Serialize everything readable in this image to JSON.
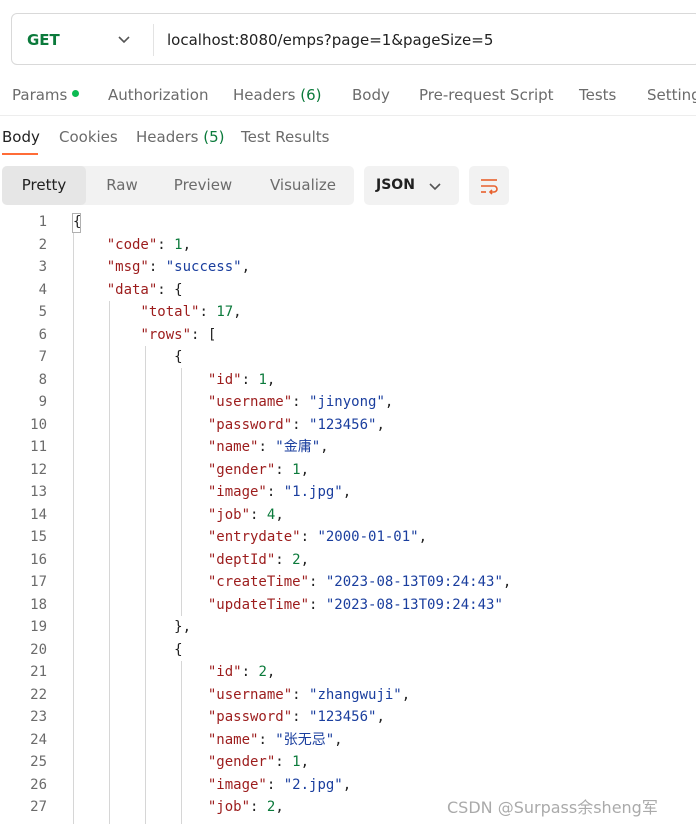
{
  "request": {
    "method": "GET",
    "url": "localhost:8080/emps?page=1&pageSize=5"
  },
  "request_tabs": [
    {
      "label": "Params",
      "count": "",
      "dot": true
    },
    {
      "label": "Authorization",
      "count": ""
    },
    {
      "label": "Headers",
      "count": "(6)"
    },
    {
      "label": "Body",
      "count": ""
    },
    {
      "label": "Pre-request Script",
      "count": ""
    },
    {
      "label": "Tests",
      "count": ""
    },
    {
      "label": "Settings",
      "count": ""
    }
  ],
  "response_tabs": [
    {
      "label": "Body",
      "count": "",
      "active": true
    },
    {
      "label": "Cookies",
      "count": ""
    },
    {
      "label": "Headers",
      "count": "(5)"
    },
    {
      "label": "Test Results",
      "count": ""
    }
  ],
  "format_tabs": [
    "Pretty",
    "Raw",
    "Preview",
    "Visualize"
  ],
  "active_format": "Pretty",
  "language": "JSON",
  "code_lines": [
    {
      "n": "1",
      "t": "{"
    },
    {
      "n": "2",
      "t": "    \"code\": 1,"
    },
    {
      "n": "3",
      "t": "    \"msg\": \"success\","
    },
    {
      "n": "4",
      "t": "    \"data\": {"
    },
    {
      "n": "5",
      "t": "        \"total\": 17,"
    },
    {
      "n": "6",
      "t": "        \"rows\": ["
    },
    {
      "n": "7",
      "t": "            {"
    },
    {
      "n": "8",
      "t": "                \"id\": 1,"
    },
    {
      "n": "9",
      "t": "                \"username\": \"jinyong\","
    },
    {
      "n": "10",
      "t": "                \"password\": \"123456\","
    },
    {
      "n": "11",
      "t": "                \"name\": \"金庸\","
    },
    {
      "n": "12",
      "t": "                \"gender\": 1,"
    },
    {
      "n": "13",
      "t": "                \"image\": \"1.jpg\","
    },
    {
      "n": "14",
      "t": "                \"job\": 4,"
    },
    {
      "n": "15",
      "t": "                \"entrydate\": \"2000-01-01\","
    },
    {
      "n": "16",
      "t": "                \"deptId\": 2,"
    },
    {
      "n": "17",
      "t": "                \"createTime\": \"2023-08-13T09:24:43\","
    },
    {
      "n": "18",
      "t": "                \"updateTime\": \"2023-08-13T09:24:43\""
    },
    {
      "n": "19",
      "t": "            },"
    },
    {
      "n": "20",
      "t": "            {"
    },
    {
      "n": "21",
      "t": "                \"id\": 2,"
    },
    {
      "n": "22",
      "t": "                \"username\": \"zhangwuji\","
    },
    {
      "n": "23",
      "t": "                \"password\": \"123456\","
    },
    {
      "n": "24",
      "t": "                \"name\": \"张无忌\","
    },
    {
      "n": "25",
      "t": "                \"gender\": 1,"
    },
    {
      "n": "26",
      "t": "                \"image\": \"2.jpg\","
    },
    {
      "n": "27",
      "t": "                \"job\": 2,"
    }
  ],
  "colors": {
    "method": "#0b7a3b",
    "key": "#9c1c1c",
    "string": "#1a3e9e",
    "number": "#0b7a3b",
    "accent": "#ff6c37"
  },
  "watermark": "CSDN @Surpass余sheng军"
}
